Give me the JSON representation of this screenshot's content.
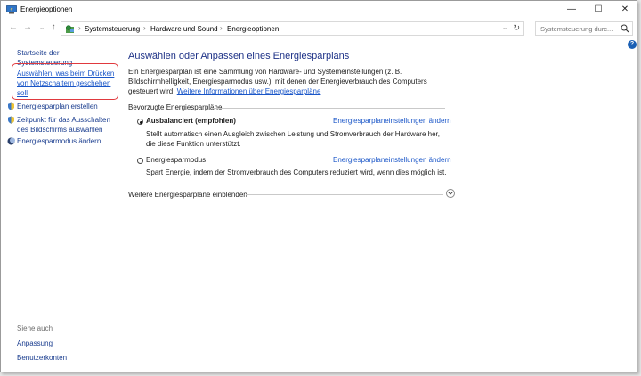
{
  "window": {
    "title": "Energieoptionen",
    "controls": {
      "minimize": "—",
      "maximize": "☐",
      "close": "✕"
    }
  },
  "navigation": {
    "back": "←",
    "forward": "→",
    "dropdown": "⌄",
    "up": "↑"
  },
  "address_bar": {
    "separator": "›",
    "breadcrumbs": [
      "Systemsteuerung",
      "Hardware und Sound",
      "Energieoptionen"
    ],
    "dropdown": "⌄",
    "refresh": "↻"
  },
  "search": {
    "placeholder": "Systemsteuerung durc..."
  },
  "help": {
    "label": "?"
  },
  "sidebar": {
    "home_link": "Startseite der Systemsteuerung",
    "links": [
      "Auswählen, was beim Drücken von Netzschaltern geschehen soll",
      "Energiesparplan erstellen",
      "Zeitpunkt für das Ausschalten des Bildschirms auswählen",
      "Energiesparmodus ändern"
    ],
    "see_also_title": "Siehe auch",
    "see_also": [
      "Anpassung",
      "Benutzerkonten"
    ]
  },
  "main": {
    "heading": "Auswählen oder Anpassen eines Energiesparplans",
    "description": "Ein Energiesparplan ist eine Sammlung von Hardware- und Systemeinstellungen (z. B. Bildschirmhelligkeit, Energiesparmodus usw.), mit denen der Energieverbrauch des Computers gesteuert wird.",
    "more_info_link": "Weitere Informationen über Energiesparpläne",
    "preferred_plans_label": "Bevorzugte Energiesparpläne",
    "plans": [
      {
        "name": "Ausbalanciert (empfohlen)",
        "selected": true,
        "settings_link": "Energiesparplaneinstellungen ändern",
        "description": "Stellt automatisch einen Ausgleich zwischen Leistung und Stromverbrauch der Hardware her, die diese Funktion unterstützt."
      },
      {
        "name": "Energiesparmodus",
        "selected": false,
        "settings_link": "Energiesparplaneinstellungen ändern",
        "description": "Spart Energie, indem der Stromverbrauch des Computers reduziert wird, wenn dies möglich ist."
      }
    ],
    "show_more_plans": "Weitere Energiesparpläne einblenden"
  },
  "colors": {
    "link": "#1a56c8",
    "heading": "#1e3287",
    "highlight_border": "#e0393e"
  }
}
